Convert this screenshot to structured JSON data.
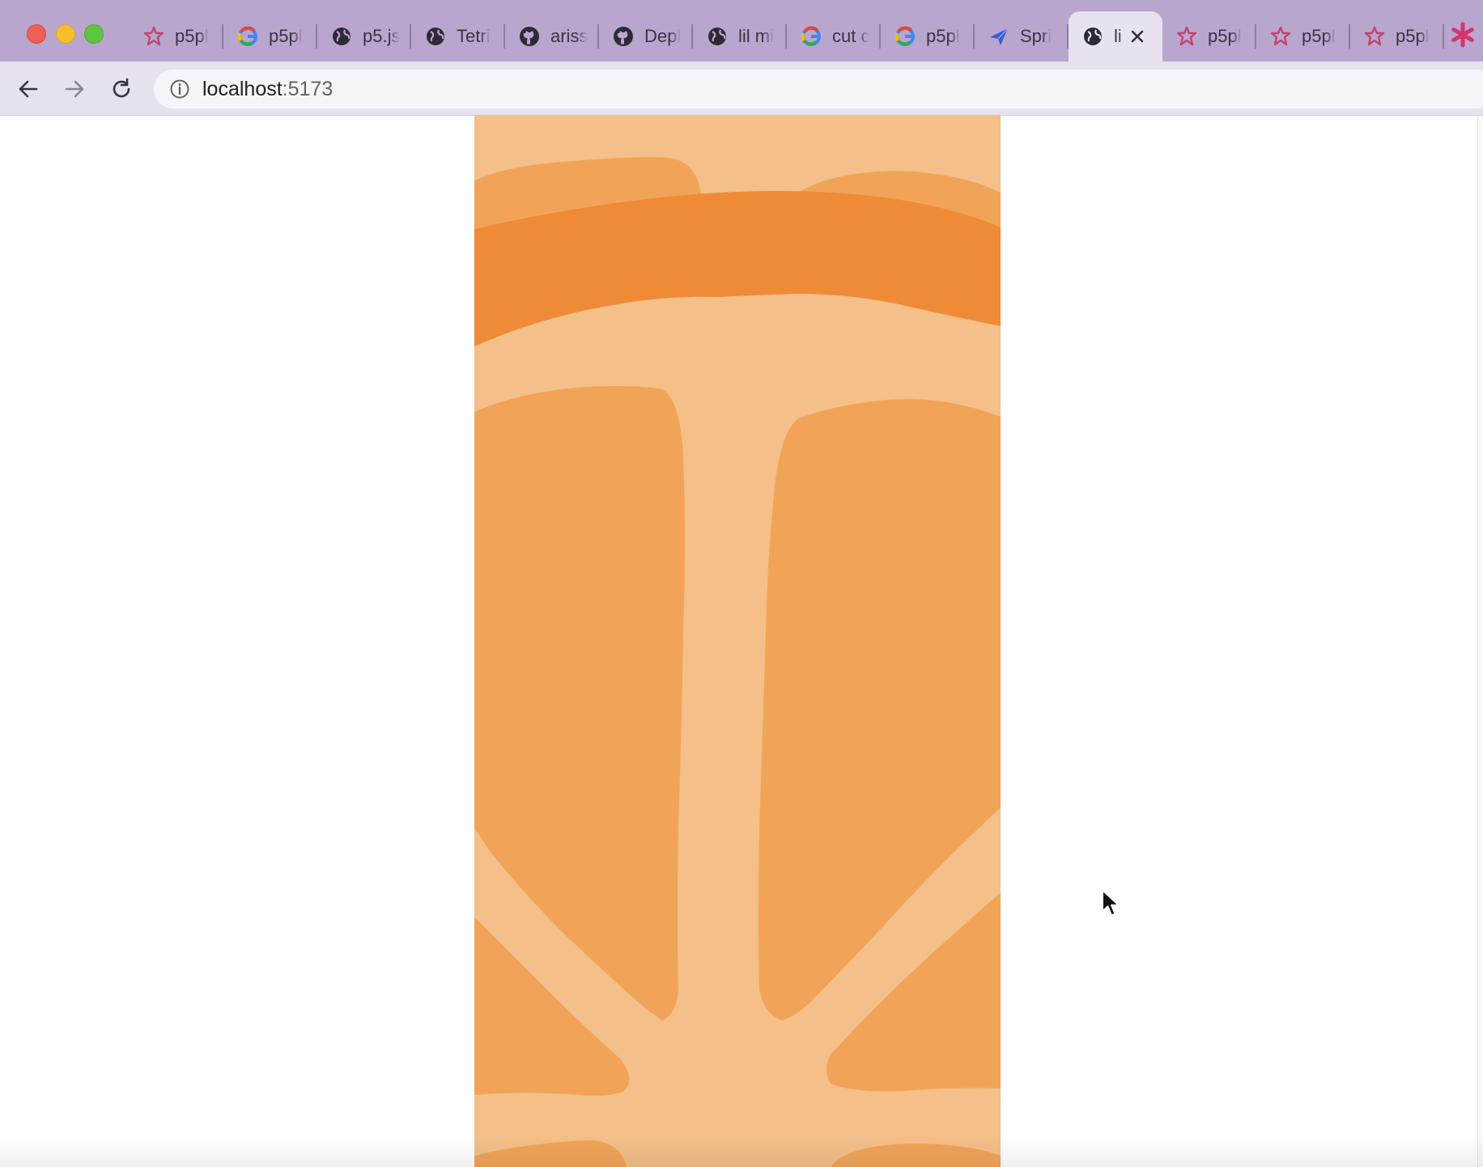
{
  "window": {
    "controls": [
      "close",
      "minimize",
      "zoom"
    ]
  },
  "tabs": [
    {
      "title": "p5pl",
      "icon": "flower-icon"
    },
    {
      "title": "p5pl",
      "icon": "google-icon"
    },
    {
      "title": "p5.js",
      "icon": "globe-icon"
    },
    {
      "title": "Tetri",
      "icon": "globe-icon"
    },
    {
      "title": "ariss",
      "icon": "github-icon"
    },
    {
      "title": "Depl",
      "icon": "github-icon"
    },
    {
      "title": "lil mi",
      "icon": "globe-icon"
    },
    {
      "title": "cut c",
      "icon": "google-icon"
    },
    {
      "title": "p5pl",
      "icon": "google-icon"
    },
    {
      "title": "Spri",
      "icon": "paper-plane-icon"
    },
    {
      "title": "li",
      "icon": "globe-icon",
      "active": true
    },
    {
      "title": "p5pl",
      "icon": "flower-icon"
    },
    {
      "title": "p5pl",
      "icon": "flower-icon"
    },
    {
      "title": "p5pl",
      "icon": "flower-icon"
    }
  ],
  "toolbar": {
    "url_host": "localhost",
    "url_port": ":5173"
  },
  "colors": {
    "tabstrip": "#b9a6cf",
    "toolbar": "#e8e2ee",
    "orange_light": "#f4bf88",
    "orange_mid": "#f1a458",
    "orange_dark": "#ef8a36"
  }
}
